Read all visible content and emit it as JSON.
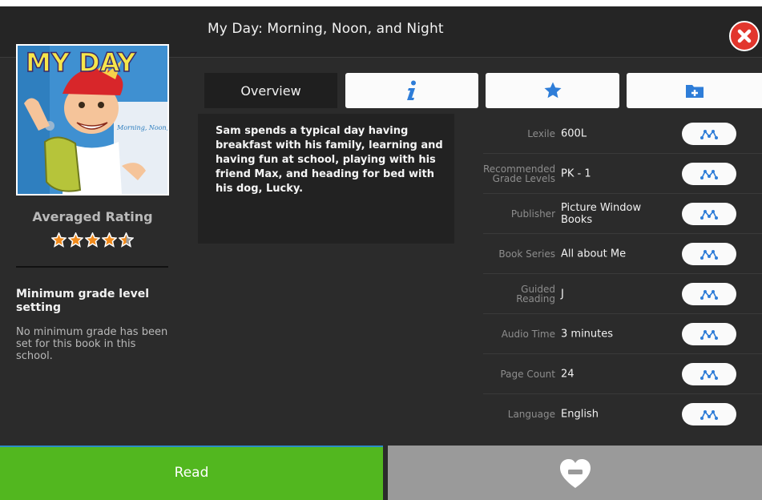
{
  "header": {
    "title": "My Day: Morning, Noon, and Night"
  },
  "cover": {
    "title_text": "MY DAY",
    "subtitle_text": "Morning, Noon, and Night"
  },
  "sidebar": {
    "rating_label": "Averaged Rating",
    "rating_value": 4.5,
    "rating_max": 5,
    "min_grade_title": "Minimum grade level setting",
    "min_grade_text": "No minimum grade has been set for this book in this school."
  },
  "tabs": {
    "overview_label": "Overview",
    "icons": [
      "info-icon",
      "star-icon",
      "add-folder-icon"
    ]
  },
  "summary": "Sam spends a typical day having breakfast with his family, learning and having fun at school, playing with his friend Max, and heading for bed with his dog, Lucky.",
  "details": [
    {
      "label": "Lexile",
      "value": "600L"
    },
    {
      "label": "Recommended Grade Levels",
      "value": "PK - 1"
    },
    {
      "label": "Publisher",
      "value": "Picture Window Books"
    },
    {
      "label": "Book Series",
      "value": "All about Me"
    },
    {
      "label": "Guided Reading",
      "value": "J"
    },
    {
      "label": "Audio Time",
      "value": "3 minutes"
    },
    {
      "label": "Page Count",
      "value": "24"
    },
    {
      "label": "Language",
      "value": "English"
    }
  ],
  "footer": {
    "read_label": "Read"
  },
  "colors": {
    "accent_blue": "#2e7dd8",
    "read_green": "#52b71f",
    "close_red": "#e2362d",
    "star_orange": "#f08a1c"
  }
}
